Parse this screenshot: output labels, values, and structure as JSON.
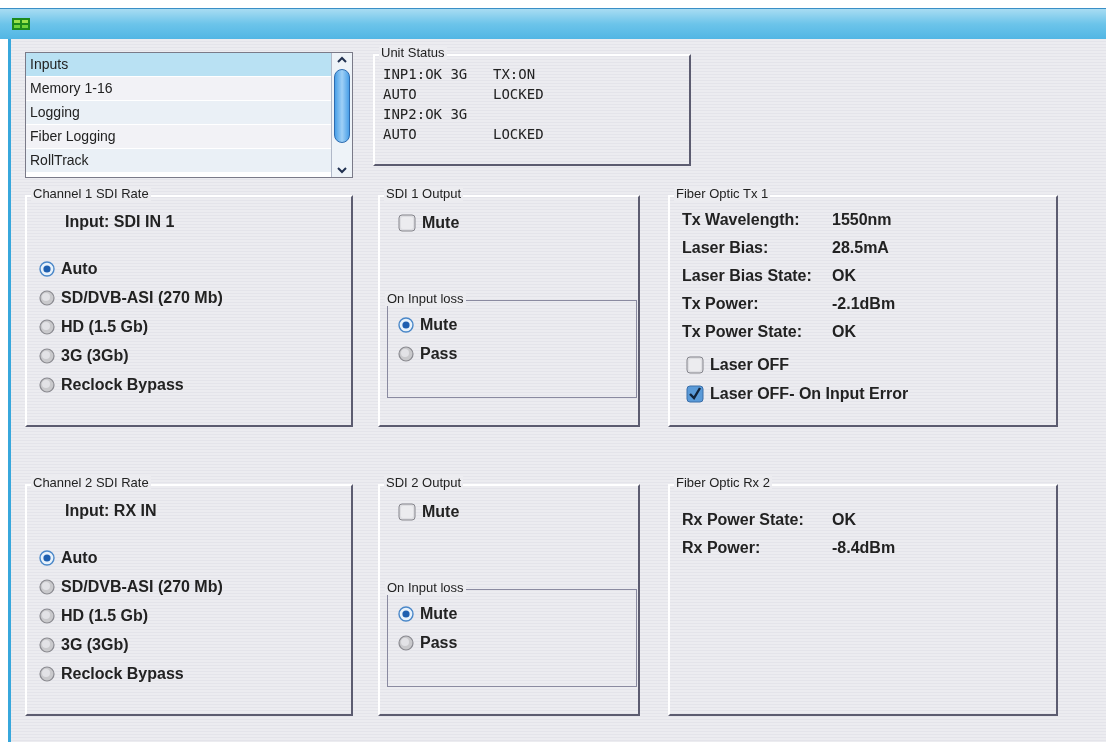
{
  "menu_list": {
    "items": [
      {
        "label": "Inputs",
        "selected": true
      },
      {
        "label": "Memory 1-16",
        "selected": false
      },
      {
        "label": "Logging",
        "selected": false
      },
      {
        "label": "Fiber Logging",
        "selected": false
      },
      {
        "label": "RollTrack",
        "selected": false
      }
    ]
  },
  "unit_status": {
    "title": "Unit Status",
    "lines": [
      [
        "INP1:OK 3G",
        "TX:ON"
      ],
      [
        "AUTO",
        "LOCKED"
      ],
      [
        "INP2:OK 3G"
      ],
      [
        "AUTO",
        "LOCKED"
      ]
    ]
  },
  "channels": [
    {
      "rate": {
        "title": "Channel 1 SDI Rate",
        "input_label": "Input: SDI IN 1",
        "options": [
          {
            "label": "Auto",
            "selected": true
          },
          {
            "label": "SD/DVB-ASI (270 Mb)",
            "selected": false
          },
          {
            "label": "HD (1.5 Gb)",
            "selected": false
          },
          {
            "label": "3G (3Gb)",
            "selected": false
          },
          {
            "label": "Reclock Bypass",
            "selected": false
          }
        ]
      },
      "output": {
        "title": "SDI 1 Output",
        "mute": {
          "label": "Mute",
          "checked": false
        },
        "loss": {
          "title": "On Input loss",
          "options": [
            {
              "label": "Mute",
              "selected": true
            },
            {
              "label": "Pass",
              "selected": false
            }
          ]
        }
      },
      "fiber": {
        "title": "Fiber Optic Tx 1",
        "readings": [
          {
            "label": "Tx Wavelength:",
            "value": "1550nm"
          },
          {
            "label": "Laser Bias:",
            "value": "28.5mA"
          },
          {
            "label": "Laser Bias State:",
            "value": "OK"
          },
          {
            "label": "Tx Power:",
            "value": "-2.1dBm"
          },
          {
            "label": "Tx Power State:",
            "value": "OK"
          }
        ],
        "checks": [
          {
            "label": "Laser OFF",
            "checked": false
          },
          {
            "label": "Laser OFF- On Input Error",
            "checked": true
          }
        ]
      }
    },
    {
      "rate": {
        "title": "Channel 2 SDI Rate",
        "input_label": "Input: RX IN",
        "options": [
          {
            "label": "Auto",
            "selected": true
          },
          {
            "label": "SD/DVB-ASI (270 Mb)",
            "selected": false
          },
          {
            "label": "HD (1.5 Gb)",
            "selected": false
          },
          {
            "label": "3G (3Gb)",
            "selected": false
          },
          {
            "label": "Reclock Bypass",
            "selected": false
          }
        ]
      },
      "output": {
        "title": "SDI 2 Output",
        "mute": {
          "label": "Mute",
          "checked": false
        },
        "loss": {
          "title": "On Input loss",
          "options": [
            {
              "label": "Mute",
              "selected": true
            },
            {
              "label": "Pass",
              "selected": false
            }
          ]
        }
      },
      "fiber": {
        "title": "Fiber Optic Rx 2",
        "readings": [
          {
            "label": "Rx Power State:",
            "value": "OK"
          },
          {
            "label": "Rx Power:",
            "value": "-8.4dBm"
          }
        ]
      }
    }
  ]
}
